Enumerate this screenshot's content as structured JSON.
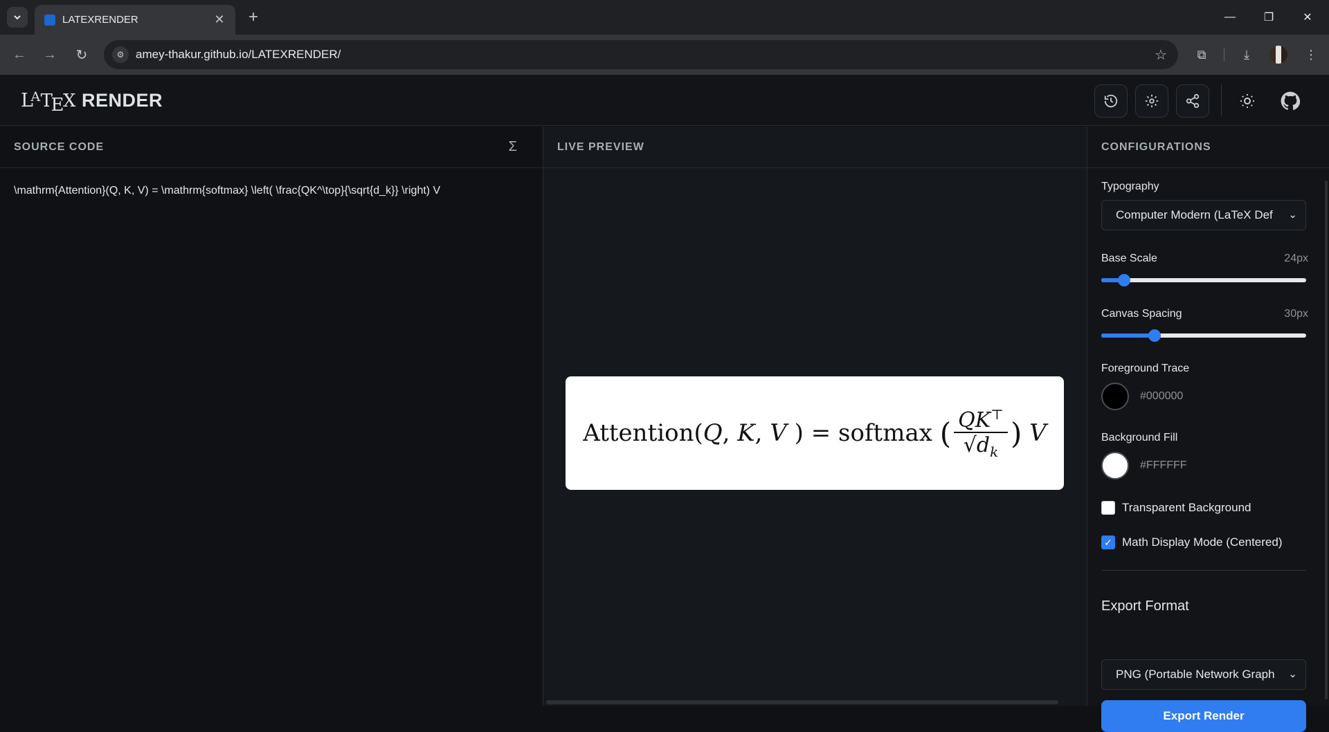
{
  "browser": {
    "tab_title": "LATEXRENDER",
    "url": "amey-thakur.github.io/LATEXRENDER/"
  },
  "app": {
    "logo_latex": "LaTeX",
    "logo_la_l": "L",
    "logo_la_a": "A",
    "logo_la_t": "T",
    "logo_la_e": "E",
    "logo_la_x": "X",
    "logo_render": "RENDER"
  },
  "source": {
    "header": "SOURCE CODE",
    "code": "\\mathrm{Attention}(Q, K, V) = \\mathrm{softmax} \\left( \\frac{QK^\\top}{\\sqrt{d_k}} \\right) V"
  },
  "preview": {
    "header": "LIVE PREVIEW",
    "math_attention": "Attention",
    "math_args_open": "(",
    "math_q": "Q",
    "math_k": "K",
    "math_v": "V",
    "math_comma": ",",
    "math_args_close": ")",
    "math_equals": "=",
    "math_softmax": "softmax",
    "math_top": "⊤",
    "math_sqrt": "√",
    "math_d": "d",
    "math_k_sub": "k"
  },
  "config": {
    "header": "CONFIGURATIONS",
    "typography_label": "Typography",
    "typography_value": "Computer Modern (LaTeX Def",
    "base_scale_label": "Base Scale",
    "base_scale_value": "24px",
    "base_scale_fraction": 0.11,
    "canvas_spacing_label": "Canvas Spacing",
    "canvas_spacing_value": "30px",
    "canvas_spacing_fraction": 0.26,
    "foreground_label": "Foreground Trace",
    "foreground_hex": "#000000",
    "background_label": "Background Fill",
    "background_hex": "#FFFFFF",
    "transparent_label": "Transparent Background",
    "transparent_checked": false,
    "display_mode_label": "Math Display Mode (Centered)",
    "display_mode_checked": true,
    "export_format_label": "Export Format",
    "export_format_value": "PNG (Portable Network Graph",
    "export_button": "Export Render"
  },
  "colors": {
    "accent": "#2f7df0",
    "foreground_swatch": "#000000",
    "background_swatch": "#FFFFFF"
  }
}
